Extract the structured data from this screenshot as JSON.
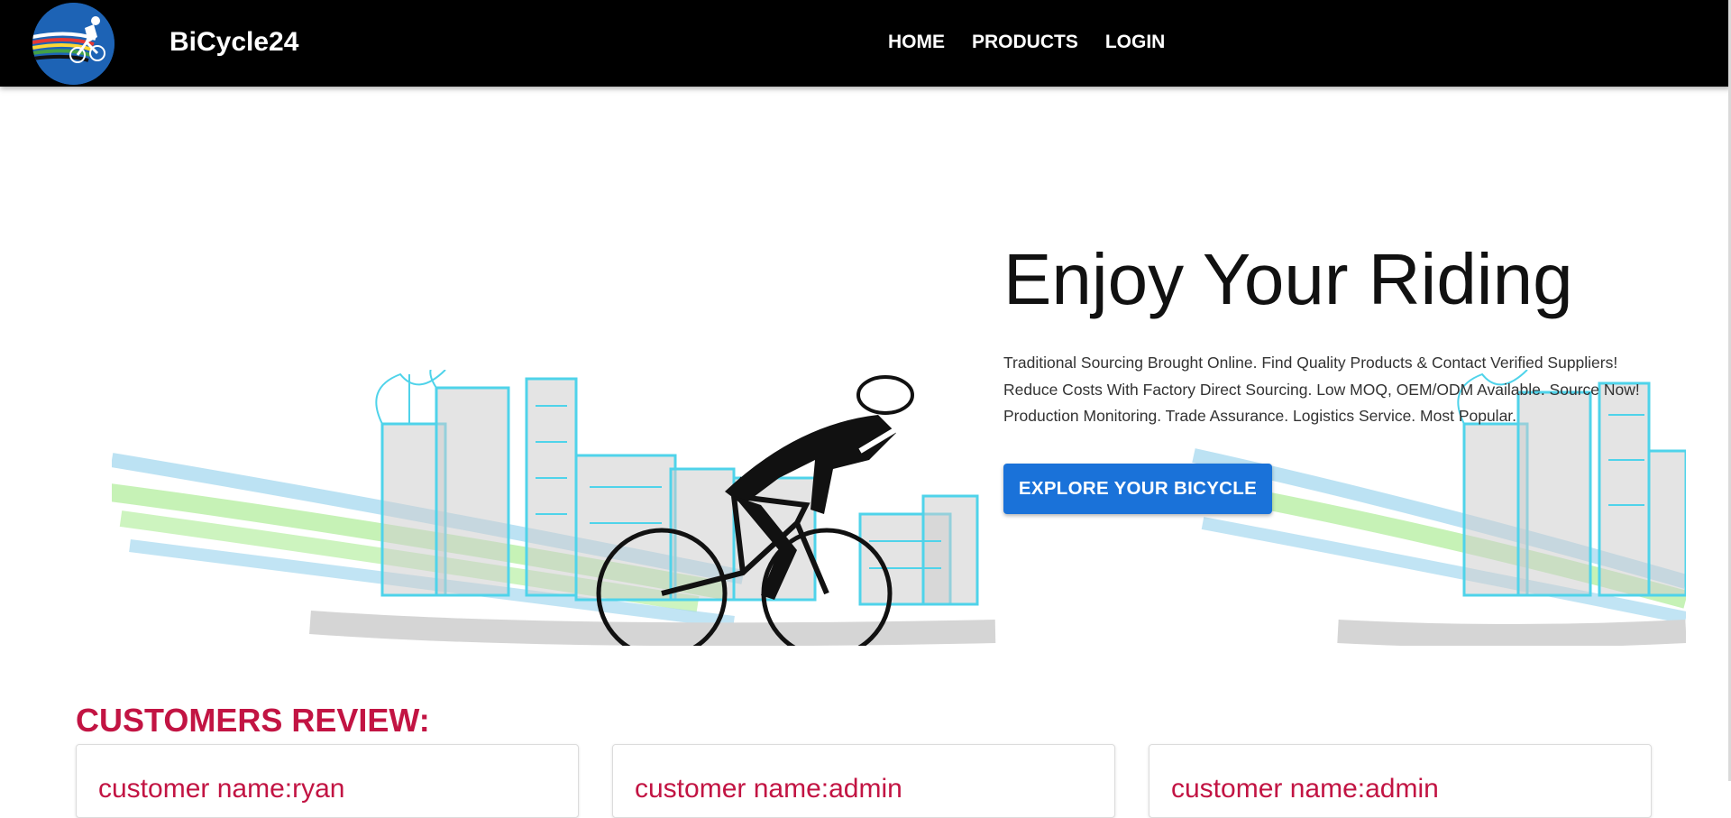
{
  "header": {
    "brand": "BiCycle24",
    "nav": [
      "HOME",
      "PRODUCTS",
      "LOGIN"
    ]
  },
  "hero": {
    "title": "Enjoy Your Riding",
    "description": [
      "Traditional Sourcing Brought Online. Find Quality Products & Contact Verified Suppliers!",
      "Reduce Costs With Factory Direct Sourcing. Low MOQ, OEM/ODM Available. Source Now!",
      "Production Monitoring. Trade Assurance. Logistics Service. Most Popular."
    ],
    "cta": "EXPLORE YOUR BICYCLE"
  },
  "reviews": {
    "heading": "CUSTOMERS REVIEW:",
    "cards": [
      {
        "name": "customer name:ryan"
      },
      {
        "name": "customer name:admin"
      },
      {
        "name": "customer name:admin"
      }
    ]
  },
  "colors": {
    "accent": "#c21443",
    "button": "#1a72d9",
    "navbar": "#000000"
  }
}
